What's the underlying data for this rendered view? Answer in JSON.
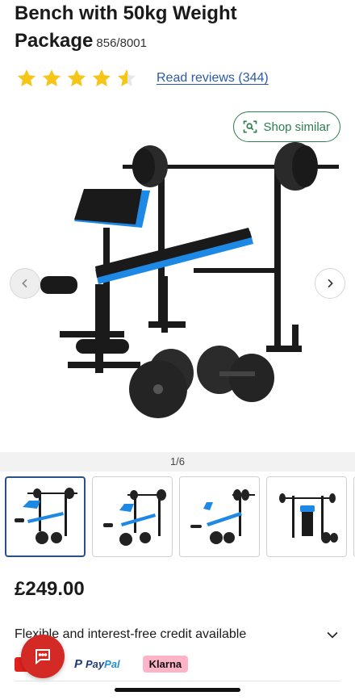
{
  "product": {
    "title": "Bench with 50kg Weight Package",
    "title_line1": "Bench with 50kg Weight",
    "title_line2": "Package",
    "sku": "856/8001",
    "rating": 4.5,
    "star_color": "#f5c518",
    "reviews_link": "Read reviews (344)"
  },
  "gallery": {
    "shop_similar_label": "Shop similar",
    "counter": "1/6",
    "current_image": 1,
    "total_images": 6,
    "prev_icon": "chevron-left-icon",
    "next_icon": "chevron-right-icon",
    "thumbnails": [
      {
        "name": "thumb-1",
        "active": true
      },
      {
        "name": "thumb-2",
        "active": false
      },
      {
        "name": "thumb-3",
        "active": false
      },
      {
        "name": "thumb-4",
        "active": false
      }
    ]
  },
  "pricing": {
    "price": "£249.00",
    "credit_text": "Flexible and interest-free credit available",
    "payment_methods": {
      "argos": "Argos",
      "paypal_pay": "Pay",
      "paypal_pal": "Pal",
      "klarna": "Klarna"
    }
  },
  "colors": {
    "accent_green": "#2e7d4f",
    "link_blue": "#2a5aa8",
    "fab_red": "#d42a25",
    "bench_blue": "#1e88e5",
    "klarna_pink": "#ffb3c7"
  }
}
